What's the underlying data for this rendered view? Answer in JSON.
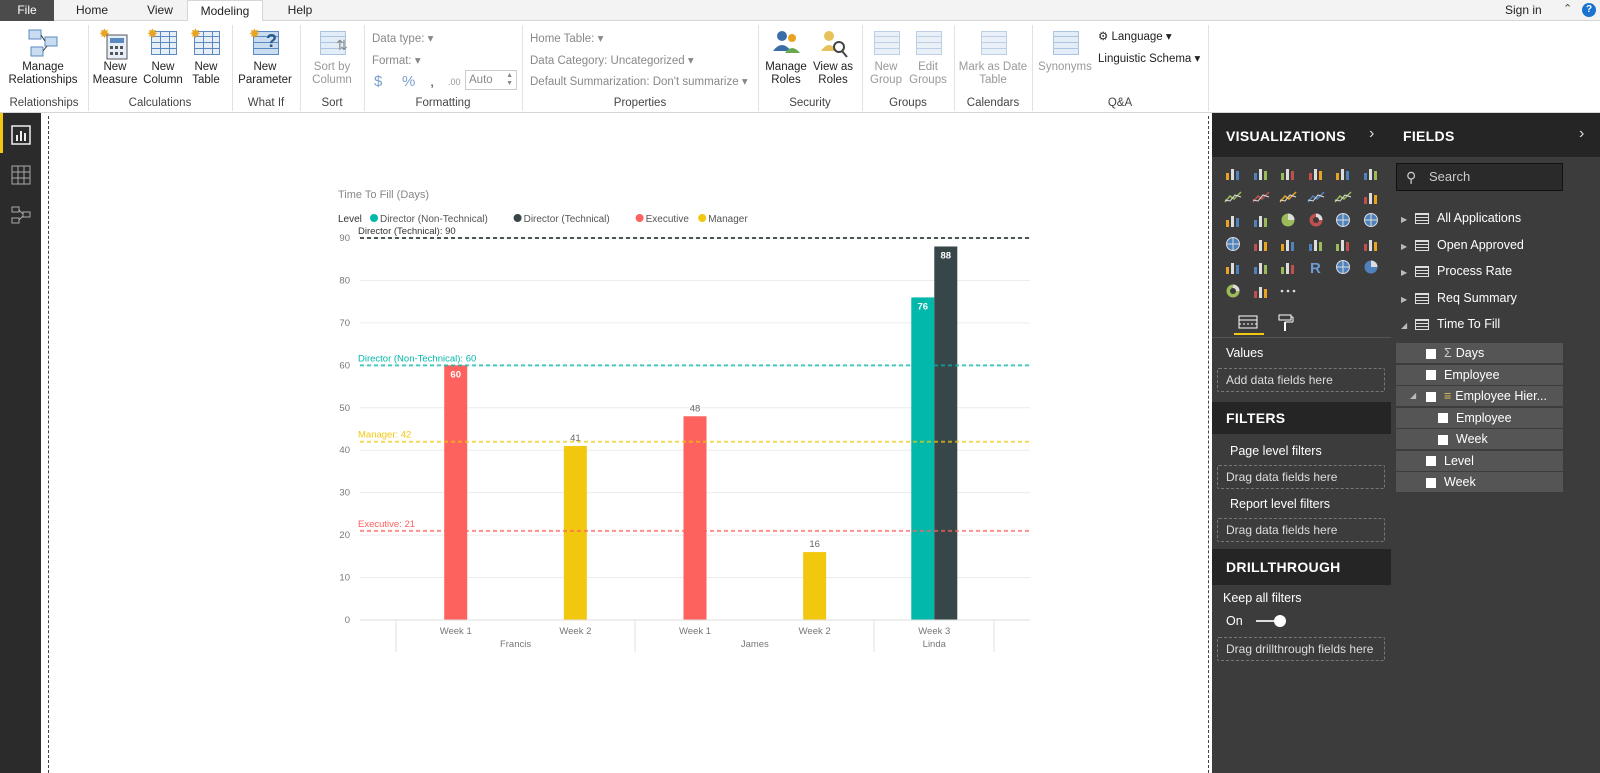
{
  "tabs": [
    "File",
    "Home",
    "View",
    "Modeling",
    "Help"
  ],
  "active_tab": "Modeling",
  "signin": "Sign in",
  "help_glyph": "?",
  "ribbon": {
    "manage_relationships": "Manage Relationships",
    "new_measure": "New Measure",
    "new_column": "New Column",
    "new_table": "New Table",
    "new_parameter": "New Parameter",
    "sort_by_column": "Sort by Column",
    "data_type": "Data type:",
    "format": "Format:",
    "currency": "$",
    "percent": "%",
    "comma": ",",
    "decimals": ".00",
    "auto": "Auto",
    "home_table": "Home Table:",
    "data_category": "Data Category: Uncategorized",
    "default_summarization": "Default Summarization: Don't summarize",
    "manage_roles": "Manage Roles",
    "view_as_roles": "View as Roles",
    "new_group": "New Group",
    "edit_groups": "Edit Groups",
    "mark_as_date_table": "Mark as Date Table",
    "synonyms": "Synonyms",
    "language": "Language",
    "linguistic_schema": "Linguistic Schema",
    "groups": {
      "relationships": "Relationships",
      "calculations": "Calculations",
      "what_if": "What If",
      "sort": "Sort",
      "formatting": "Formatting",
      "properties": "Properties",
      "security": "Security",
      "groups": "Groups",
      "calendars": "Calendars",
      "qa": "Q&A"
    }
  },
  "visualizations": {
    "title": "VISUALIZATIONS",
    "values_label": "Values",
    "add_fields": "Add data fields here",
    "filters_title": "FILTERS",
    "page_filters": "Page level filters",
    "report_filters": "Report level filters",
    "drag_fields": "Drag data fields here",
    "drillthrough_title": "DRILLTHROUGH",
    "keep_all_filters": "Keep all filters",
    "toggle_label": "On",
    "drag_drill": "Drag drillthrough fields here"
  },
  "fields": {
    "title": "FIELDS",
    "search_placeholder": "Search",
    "tables": [
      "All Applications",
      "Open Approved",
      "Process Rate",
      "Req Summary",
      "Time To Fill"
    ],
    "items": [
      {
        "label": "Days",
        "sigma": "Σ"
      },
      {
        "label": "Employee"
      },
      {
        "label": "Employee Hier..."
      },
      {
        "label": "Employee"
      },
      {
        "label": "Week"
      },
      {
        "label": "Level"
      },
      {
        "label": "Week"
      }
    ]
  },
  "colors": {
    "teal": "#01b8aa",
    "dark": "#374649",
    "red": "#fd625e",
    "yellow": "#f2c80f"
  },
  "chart_data": {
    "type": "bar",
    "title": "Time To Fill (Days)",
    "legend_title": "Level",
    "legend_position": "top-left",
    "ylim": [
      0,
      90
    ],
    "yticks": [
      0,
      10,
      20,
      30,
      40,
      50,
      60,
      70,
      80,
      90
    ],
    "grid": true,
    "groups": [
      {
        "name": "Francis",
        "weeks": [
          "Week 1",
          "Week 2"
        ]
      },
      {
        "name": "James",
        "weeks": [
          "Week 1",
          "Week 2"
        ]
      },
      {
        "name": "Linda",
        "weeks": [
          "Week 3"
        ]
      }
    ],
    "series": [
      {
        "name": "Director (Non-Technical)",
        "color": "#01b8aa"
      },
      {
        "name": "Director (Technical)",
        "color": "#374649"
      },
      {
        "name": "Executive",
        "color": "#fd625e"
      },
      {
        "name": "Manager",
        "color": "#f2c80f"
      }
    ],
    "bars": [
      {
        "category": "Francis / Week 1",
        "series": "Executive",
        "value": 60,
        "label": "60"
      },
      {
        "category": "Francis / Week 2",
        "series": "Manager",
        "value": 41,
        "label": "41"
      },
      {
        "category": "James / Week 1",
        "series": "Executive",
        "value": 48,
        "label": "48"
      },
      {
        "category": "James / Week 2",
        "series": "Manager",
        "value": 16,
        "label": "16"
      },
      {
        "category": "Linda / Week 3",
        "series": "Director (Non-Technical)",
        "value": 76,
        "label": "76"
      },
      {
        "category": "Linda / Week 3",
        "series": "Director (Technical)",
        "value": 88,
        "label": "88"
      }
    ],
    "reference_lines": [
      {
        "label": "Director (Technical): 90",
        "value": 90,
        "color": "#374649"
      },
      {
        "label": "Director (Non-Technical): 60",
        "value": 60,
        "color": "#01b8aa"
      },
      {
        "label": "Manager: 42",
        "value": 42,
        "color": "#f2c80f"
      },
      {
        "label": "Executive: 21",
        "value": 21,
        "color": "#fd625e"
      }
    ]
  }
}
